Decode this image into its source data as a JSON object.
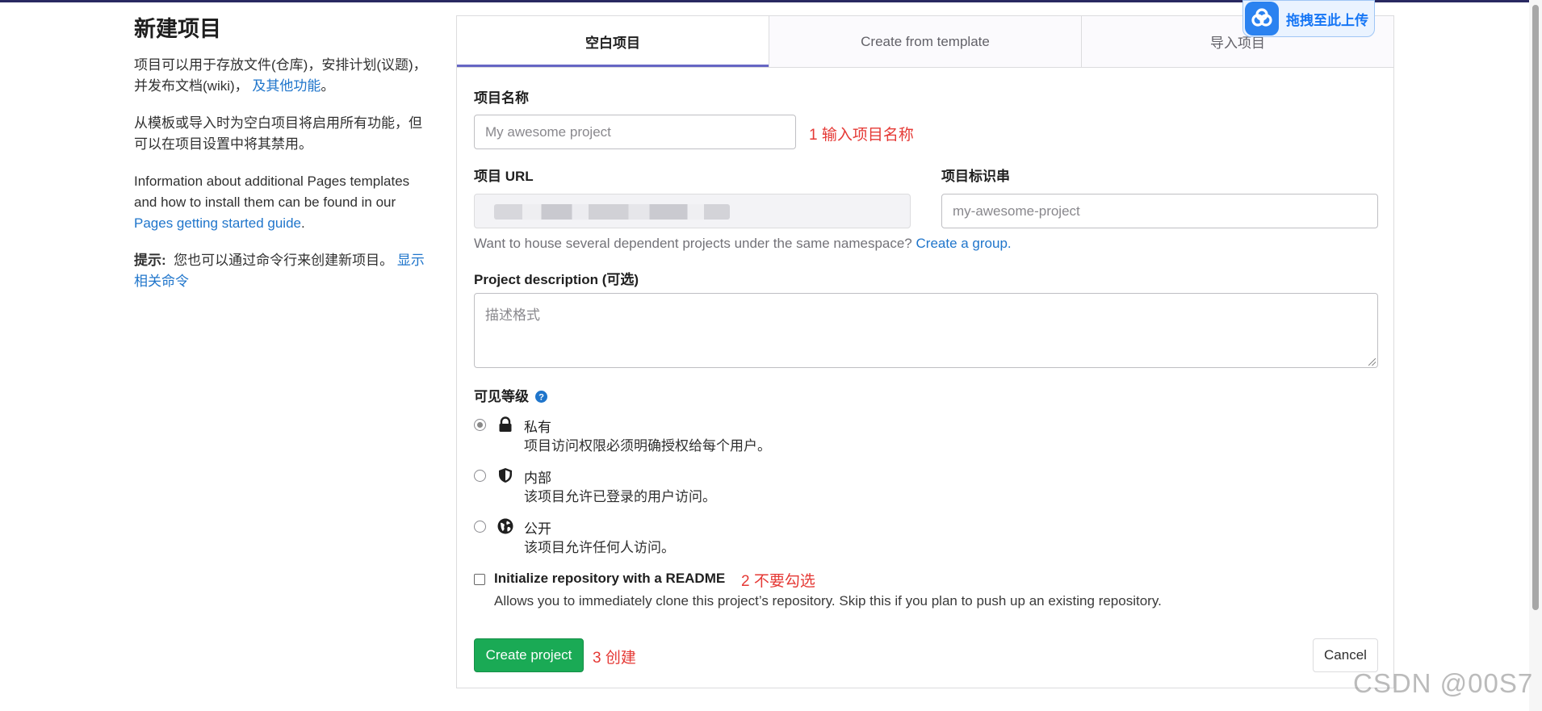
{
  "sidebar": {
    "title": "新建项目",
    "para1": "项目可以用于存放文件(仓库)，安排计划(议题)，并发布文档(wiki)，",
    "para1_link": "及其他功能",
    "para1_end": "。",
    "para2": "从模板或导入时为空白项目将启用所有功能，但可以在项目设置中将其禁用。",
    "para3": "Information about additional Pages templates and how to install them can be found in our",
    "para3_link": "Pages getting started guide",
    "para3_end": ".",
    "tip_label": "提示:",
    "tip_text": "您也可以通过命令行来创建新项目。",
    "tip_link": "显示相关命令"
  },
  "tabs": [
    {
      "label": "空白项目",
      "active": true
    },
    {
      "label": "Create from template",
      "active": false
    },
    {
      "label": "导入项目",
      "active": false
    }
  ],
  "form": {
    "name_label": "项目名称",
    "name_placeholder": "My awesome project",
    "name_annotation": "1 输入项目名称",
    "url_label": "项目 URL",
    "slug_label": "项目标识串",
    "slug_placeholder": "my-awesome-project",
    "namespace_help": "Want to house several dependent projects under the same namespace?",
    "namespace_link": "Create a group.",
    "desc_label": "Project description",
    "desc_optional": "(可选)",
    "desc_placeholder": "描述格式",
    "visibility_label": "可见等级",
    "visibility_options": [
      {
        "title": "私有",
        "desc": "项目访问权限必须明确授权给每个用户。",
        "icon": "lock-icon",
        "checked": true
      },
      {
        "title": "内部",
        "desc": "该项目允许已登录的用户访问。",
        "icon": "shield-icon",
        "checked": false
      },
      {
        "title": "公开",
        "desc": "该项目允许任何人访问。",
        "icon": "globe-icon",
        "checked": false
      }
    ],
    "readme_label": "Initialize repository with a README",
    "readme_annotation": "2 不要勾选",
    "readme_help": "Allows you to immediately clone this project’s repository. Skip this if you plan to push up an existing repository.",
    "readme_checked": false,
    "create_button": "Create project",
    "create_annotation": "3 创建",
    "cancel_button": "Cancel"
  },
  "upload_widget": {
    "label": "拖拽至此上传",
    "icon": "cloud-upload-icon"
  },
  "watermark": "CSDN @00S7",
  "colors": {
    "accent": "#6666c4",
    "primary_button": "#1aaa55",
    "link": "#1f75cb",
    "annotation": "#e53935"
  }
}
